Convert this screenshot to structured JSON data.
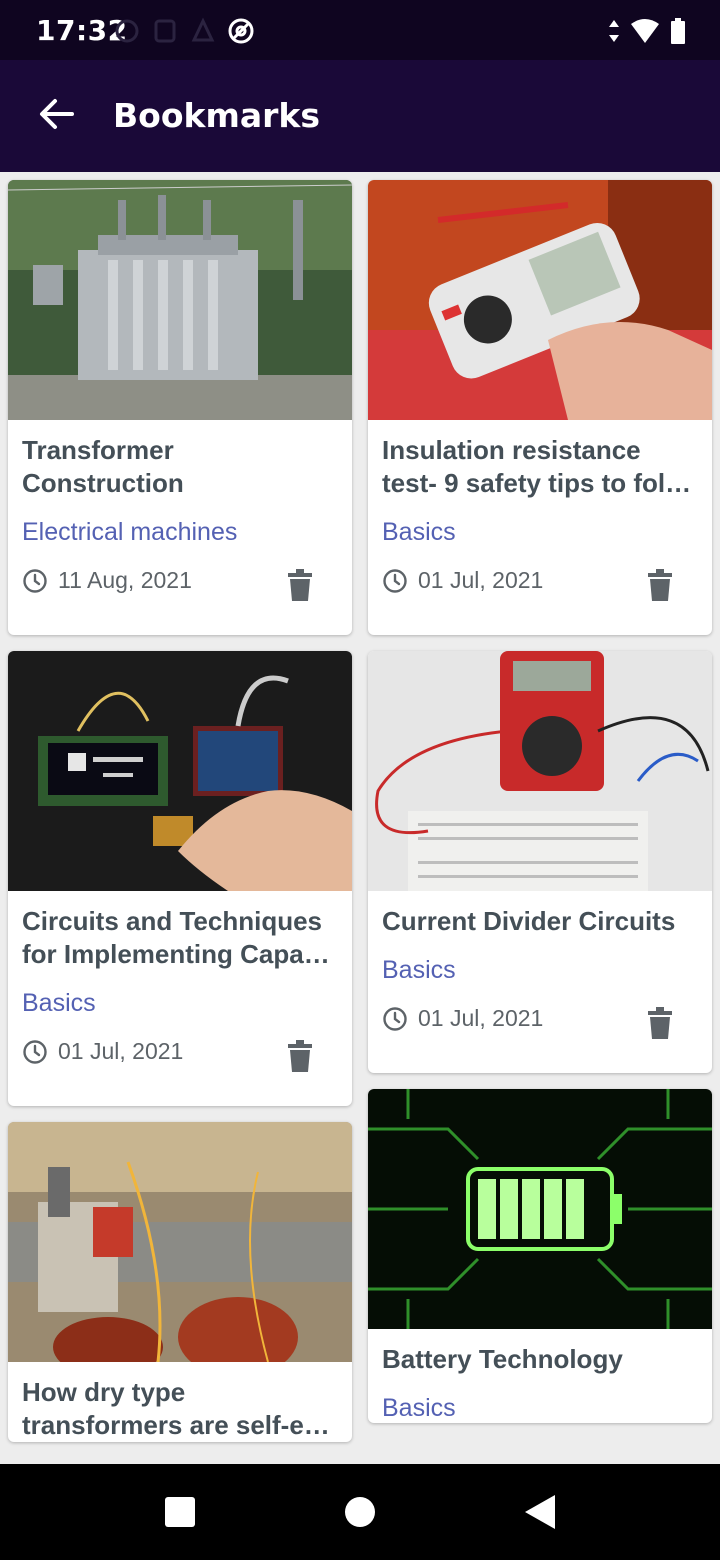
{
  "status_bar": {
    "time": "17:32"
  },
  "app_bar": {
    "title": "Bookmarks"
  },
  "cards": [
    {
      "title": "Transformer Construction",
      "category": "Electrical machines",
      "date": "11 Aug, 2021",
      "image": "transformer-substation"
    },
    {
      "title": "Insulation resistance test- 9 safety tips to fol…",
      "category": "Basics",
      "date": "01 Jul, 2021",
      "image": "insulation-tester"
    },
    {
      "title": "Circuits and Techniques for Implementing Capa…",
      "category": "Basics",
      "date": "01 Jul, 2021",
      "image": "touch-sensor-board"
    },
    {
      "title": "Current Divider Circuits",
      "category": "Basics",
      "date": "01 Jul, 2021",
      "image": "multimeter-breadboard"
    },
    {
      "title": "How dry type transformers are self-e…",
      "category": "",
      "date": "",
      "image": "dry-type-transformer"
    },
    {
      "title": "Battery Technology",
      "category": "Basics",
      "date": "",
      "image": "battery-circuit"
    }
  ],
  "colors": {
    "accent": "#5461b3",
    "app_bar": "#1a0938",
    "status_bar": "#0f0520",
    "title_text": "#444f57"
  }
}
